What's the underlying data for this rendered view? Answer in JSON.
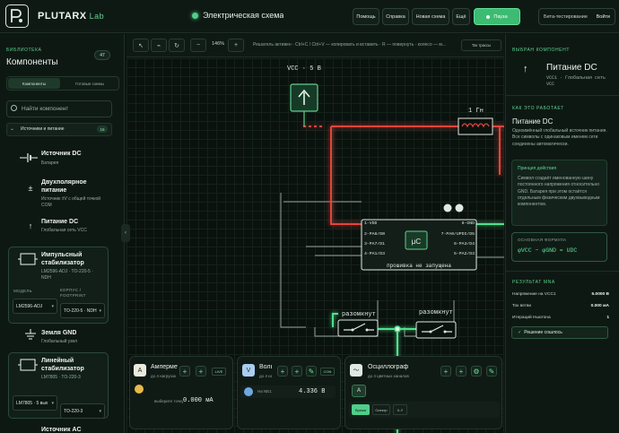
{
  "header": {
    "logo": "PLUTARX",
    "logo_suffix": "Lab",
    "doc_title": "Электрическая схема",
    "buttons": [
      "Помощь",
      "Справка",
      "Новая схема",
      "Ещё"
    ],
    "pause": "Пауза",
    "beta": "Бета-тестирование",
    "login": "Войти"
  },
  "library": {
    "caption": "БИБЛИОТЕКА",
    "title": "Компоненты",
    "count": "47",
    "tab_components": "Компоненты",
    "tab_ready": "Готовые схемы",
    "search_placeholder": "Найти компонент",
    "section": "Источники и питание",
    "section_count": "16",
    "items": [
      {
        "name": "Источник DC",
        "sub": "Батарея"
      },
      {
        "name": "Двухполярное питание",
        "sub": "Источник ±V с общей точкой COM"
      },
      {
        "name": "Питание DC",
        "sub": "Глобальная сеть VCC"
      },
      {
        "name": "Импульсный стабилизатор",
        "sub": "LM2596-ADJ · TO-220-5 · NDH"
      },
      {
        "name": "Земля GND",
        "sub": "Глобальный узел"
      },
      {
        "name": "Линейный стабилизатор",
        "sub": "LM7805 · TO-220-3"
      },
      {
        "name": "Источник AC",
        "sub": ""
      }
    ],
    "model_label": "МОДЕЛЬ",
    "package_label": "КОРПУС / FOOTPRINT",
    "buck_model": "LM2596-ADJ",
    "buck_package": "TO-220-5 · NDH",
    "lin_model": "LM7805 · 5 вых",
    "lin_package": "TO-220-3"
  },
  "toolbar": {
    "zoom": "146%",
    "hint": "Решатель активен · Ctrl+C / Ctrl+V — копировать и вставить · R — повернуть · колесо — м...",
    "trace": "Ток трассы"
  },
  "circuit": {
    "vcc_label": "VCC · 5 В",
    "inductor_label": "1 Гн",
    "chip_pins_left": [
      "1-VDD",
      "2-PA6/D0",
      "3-PA7/D1",
      "4-PA1/D3"
    ],
    "chip_pins_right": [
      "8-GND",
      "7-PA0/UPDI/D5",
      "6-PA3/D4",
      "5-PA2/D3"
    ],
    "chip_status": "прошивка не запущена",
    "switch1_label": "разомкнут",
    "switch2_label": "разомкнут"
  },
  "instruments": {
    "ammeter": {
      "title": "Амперметр",
      "sub": "до 4 нагрузок",
      "value": "0.000 мА",
      "pick": "выберите точку",
      "live": "LIVE"
    },
    "voltmeter": {
      "title": "Вольтметр",
      "sub": "до 4 нагрузок",
      "value": "4.336 В",
      "net": "На NE1",
      "con": "CON"
    },
    "scope": {
      "title": "Осциллограф",
      "sub": "до 4 цветных каналов",
      "tabs": [
        "Время",
        "Спектр",
        "X-Y"
      ]
    }
  },
  "inspector": {
    "caption": "ВЫБРАН КОМПОНЕНТ",
    "name": "Питание DC",
    "sub": "VCC1 · Глобальная сеть VCC",
    "how_caption": "КАК ЭТО РАБОТАЕТ",
    "how_title": "Питание DC",
    "how_text": "Одноимённый глобальный источник питания. Все символы с одинаковым именем сети соединены автоматически.",
    "principle_title": "Принцип действия",
    "principle_text": "Символ создаёт именованную шину постоянного напряжения относительно GND. Батарея при этом остаётся отдельным физическим двухвыводным компонентом.",
    "formula_title": "ОСНОВНАЯ ФОРМУЛА",
    "formula": "φVCC − φGND = UDC",
    "results_caption": "РЕЗУЛЬТАТ MNA",
    "results": [
      {
        "label": "Напряжение на VCC1",
        "value": "5.0000 В"
      },
      {
        "label": "Ток ветви",
        "value": "0.000 мА"
      },
      {
        "label": "Итераций Ньютона",
        "value": "1"
      }
    ],
    "status": "Решение сошлось"
  },
  "colors": {
    "accent": "#3dbb72",
    "wire_red": "#e0453c",
    "wire_green": "#4fe08a",
    "wire_gray": "#7c8c84"
  }
}
